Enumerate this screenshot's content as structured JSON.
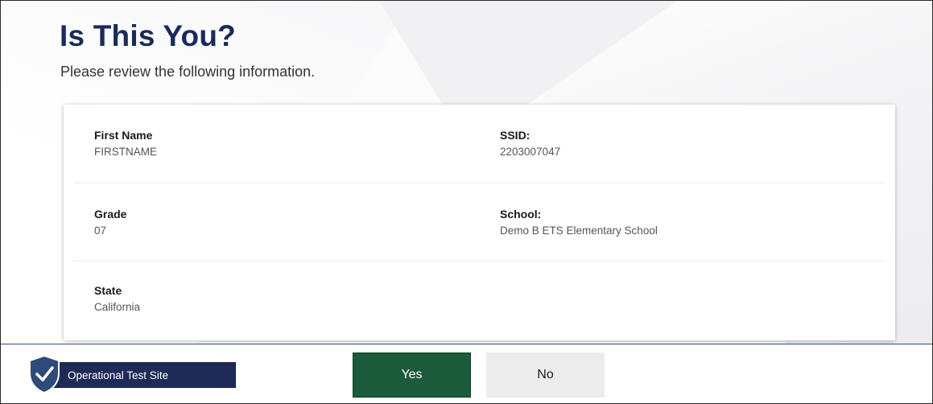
{
  "header": {
    "title": "Is This You?",
    "subtitle": "Please review the following information."
  },
  "student": {
    "first_name": {
      "label": "First Name",
      "value": "FIRSTNAME"
    },
    "ssid": {
      "label": "SSID:",
      "value": "2203007047"
    },
    "grade": {
      "label": "Grade",
      "value": "07"
    },
    "school": {
      "label": "School:",
      "value": "Demo B ETS Elementary School"
    },
    "state": {
      "label": "State",
      "value": "California"
    }
  },
  "footer": {
    "site_label": "Operational Test Site",
    "yes_label": "Yes",
    "no_label": "No"
  },
  "icons": {
    "site": "shield-check-icon"
  },
  "colors": {
    "title": "#1b2a5c",
    "yes_button": "#1b5a3a",
    "no_button": "#ececec",
    "site_badge": "#1f2b57"
  }
}
